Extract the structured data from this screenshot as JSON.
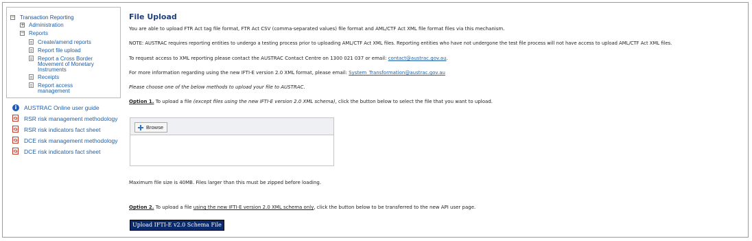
{
  "nav": {
    "tree": [
      {
        "label": "Transaction Reporting",
        "toggle": "−"
      },
      {
        "label": "Administration",
        "toggle": "+"
      },
      {
        "label": "Reports",
        "toggle": "−"
      },
      {
        "label": "Create/amend reports"
      },
      {
        "label": "Report file upload"
      },
      {
        "label": "Report a Cross Border"
      },
      {
        "label": "Movement of Monetary"
      },
      {
        "label": "Instruments"
      },
      {
        "label": "Receipts"
      },
      {
        "label": "Report access"
      },
      {
        "label": "management"
      }
    ],
    "links": [
      {
        "label": "AUSTRAC Online user guide",
        "icon": "info-icon"
      },
      {
        "label": "RSR risk management methodology",
        "icon": "pdf-icon"
      },
      {
        "label": "RSR risk indicators fact sheet",
        "icon": "pdf-icon"
      },
      {
        "label": "DCE risk management methodology",
        "icon": "pdf-icon"
      },
      {
        "label": "DCE risk indicators fact sheet",
        "icon": "pdf-icon"
      }
    ]
  },
  "main": {
    "title": "File Upload",
    "para1": "You are able to upload FTR Act tag file format, FTR Act CSV (comma-separated values) file format and AML/CTF Act XML file format files via this mechanism.",
    "para2": "NOTE: AUSTRAC requires reporting entities to undergo a testing process prior to uploading AML/CTF Act XML files. Reporting entities who have not undergone the test file process will not have access to upload AML/CTF Act XML files.",
    "para3_text": "To request access to XML reporting please contact the AUSTRAC Contact Centre on 1300 021 037 or email: ",
    "para3_link": "contact@austrac.gov.au",
    "para3_end": ".",
    "para4_text": "For more information regarding using the new IFTI-E version 2.0 XML format, please email: ",
    "para4_link": "System_Transformation@austrac.gov.au",
    "para5": "Please choose one of the below methods to upload your file to AUSTRAC.",
    "opt1_label": "Option 1.",
    "opt1_text": " To upload a file ",
    "opt1_italic": "(except files using the new IFTI-E version 2.0 XML schema)",
    "opt1_end": ", click the button below to select the file that you want to upload.",
    "browse_label": "Browse",
    "max_size": "Maximum file size is 40MB. Files larger than this must be zipped before loading.",
    "opt2_label": "Option 2.",
    "opt2_text": " To upload a file ",
    "opt2_underline": "using the new IFTI-E version 2.0 XML schema only",
    "opt2_end": ", click the button below to be transferred to the new API user page.",
    "upload_button": "Upload IFTI-E v2.0 Schema File"
  }
}
